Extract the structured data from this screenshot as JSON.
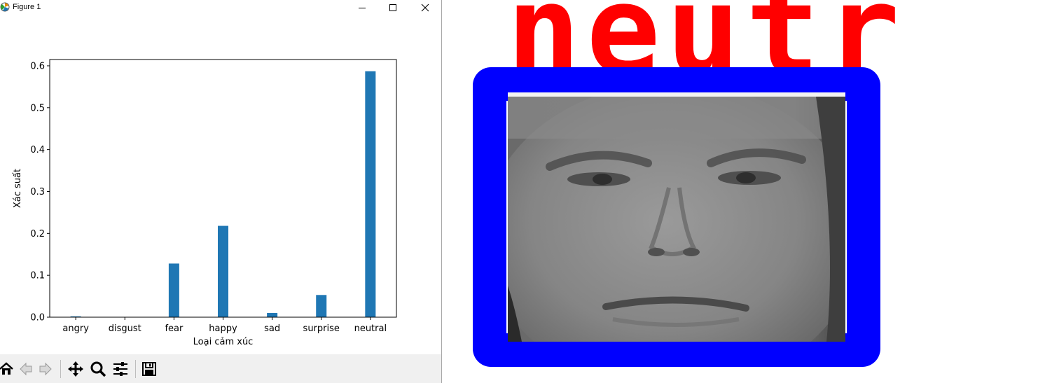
{
  "window": {
    "title": "Figure 1",
    "controls": {
      "minimize": "–",
      "maximize": "☐",
      "close": "✕"
    }
  },
  "colors": {
    "bar": "#1f77b4",
    "detection_box": "#0000ff",
    "detection_label": "#ff0000"
  },
  "chart_data": {
    "type": "bar",
    "categories": [
      "angry",
      "disgust",
      "fear",
      "happy",
      "sad",
      "surprise",
      "neutral"
    ],
    "values": [
      0.002,
      0.0,
      0.128,
      0.218,
      0.01,
      0.053,
      0.587
    ],
    "xlabel": "Loại cảm xúc",
    "ylabel": "Xác suất",
    "ylim": [
      0.0,
      0.615
    ],
    "yticks": [
      "0.0",
      "0.1",
      "0.2",
      "0.3",
      "0.4",
      "0.5",
      "0.6"
    ],
    "ytick_values": [
      0.0,
      0.1,
      0.2,
      0.3,
      0.4,
      0.5,
      0.6
    ],
    "grid": false
  },
  "toolbar": {
    "buttons": [
      {
        "name": "home-icon",
        "glyph": "⌂"
      },
      {
        "name": "back-icon",
        "glyph": "⇐"
      },
      {
        "name": "forward-icon",
        "glyph": "⇒"
      },
      {
        "name": "pan-icon",
        "glyph": "✥"
      },
      {
        "name": "zoom-icon",
        "glyph": "⌕"
      },
      {
        "name": "configure-subplots-icon",
        "glyph": "☰"
      },
      {
        "name": "save-icon",
        "glyph": "💾"
      }
    ]
  },
  "detection": {
    "label": "neutr"
  }
}
